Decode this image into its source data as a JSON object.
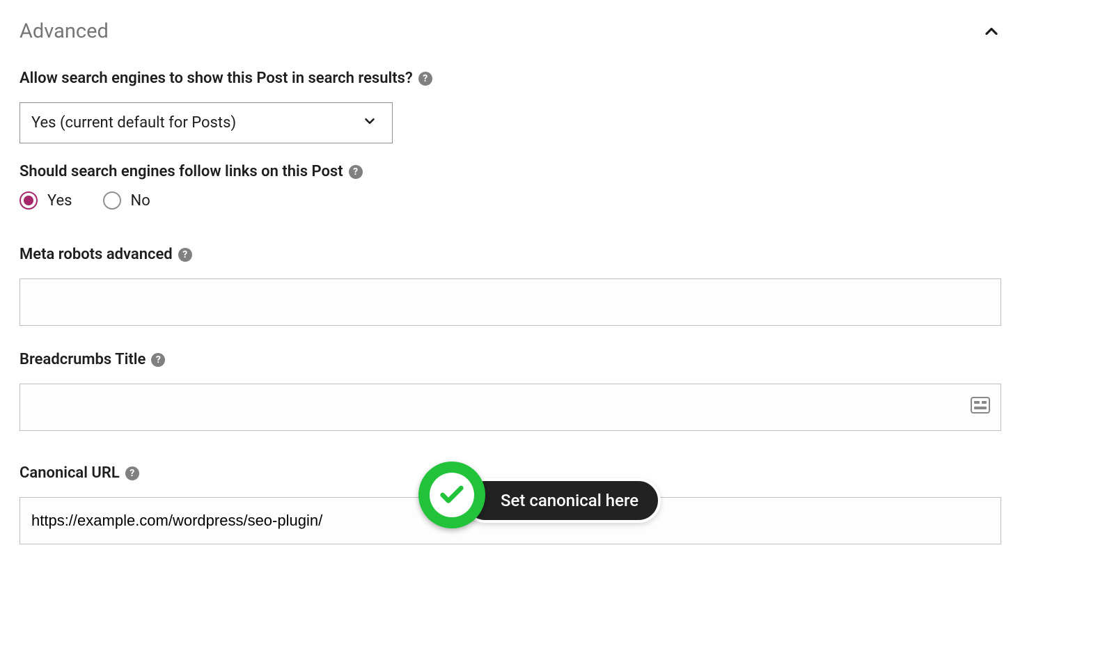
{
  "panel": {
    "title": "Advanced"
  },
  "allow_search": {
    "label": "Allow search engines to show this Post in search results?",
    "selected": "Yes (current default for Posts)"
  },
  "follow_links": {
    "label": "Should search engines follow links on this Post",
    "option_yes": "Yes",
    "option_no": "No",
    "selected": "yes"
  },
  "meta_robots": {
    "label": "Meta robots advanced",
    "value": ""
  },
  "breadcrumbs": {
    "label": "Breadcrumbs Title",
    "value": ""
  },
  "canonical": {
    "label": "Canonical URL",
    "value": "https://example.com/wordpress/seo-plugin/"
  },
  "callout": {
    "text": "Set canonical here"
  }
}
